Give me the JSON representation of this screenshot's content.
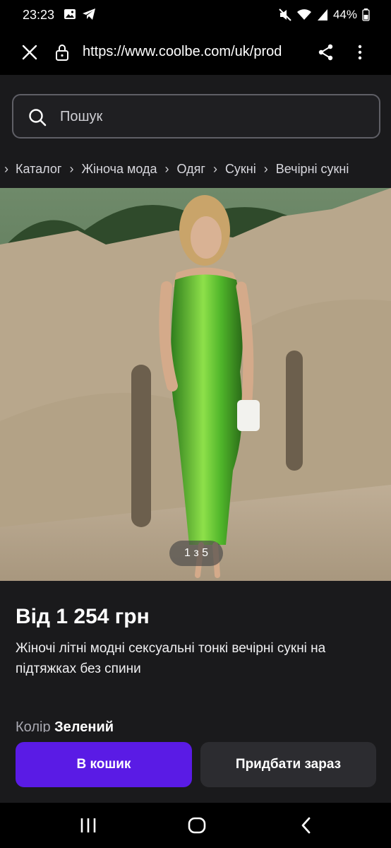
{
  "status_bar": {
    "time": "23:23",
    "battery": "44%",
    "icons": [
      "gallery-icon",
      "telegram-icon",
      "mute-icon",
      "wifi-icon",
      "signal-icon",
      "battery-icon"
    ]
  },
  "url_bar": {
    "url": "https://www.coolbe.com/uk/prod",
    "icons": [
      "close-icon",
      "lock-icon",
      "share-icon",
      "more-vert-icon"
    ]
  },
  "search": {
    "placeholder": "Пошук"
  },
  "breadcrumbs": [
    "Каталог",
    "Жіноча мода",
    "Одяг",
    "Сукні",
    "Вечірні сукні"
  ],
  "gallery": {
    "counter": "1 з 5"
  },
  "product": {
    "price": "Від 1 254 грн",
    "title": "Жіночі літні модні сексуальні тонкі вечірні сукні на підтяжках без спини",
    "color_label": "Колір",
    "color_value": "Зелений"
  },
  "actions": {
    "cart": "В кошик",
    "buy_now": "Придбати зараз"
  },
  "colors": {
    "accent": "#5a1be5",
    "background": "#1a1a1c"
  }
}
